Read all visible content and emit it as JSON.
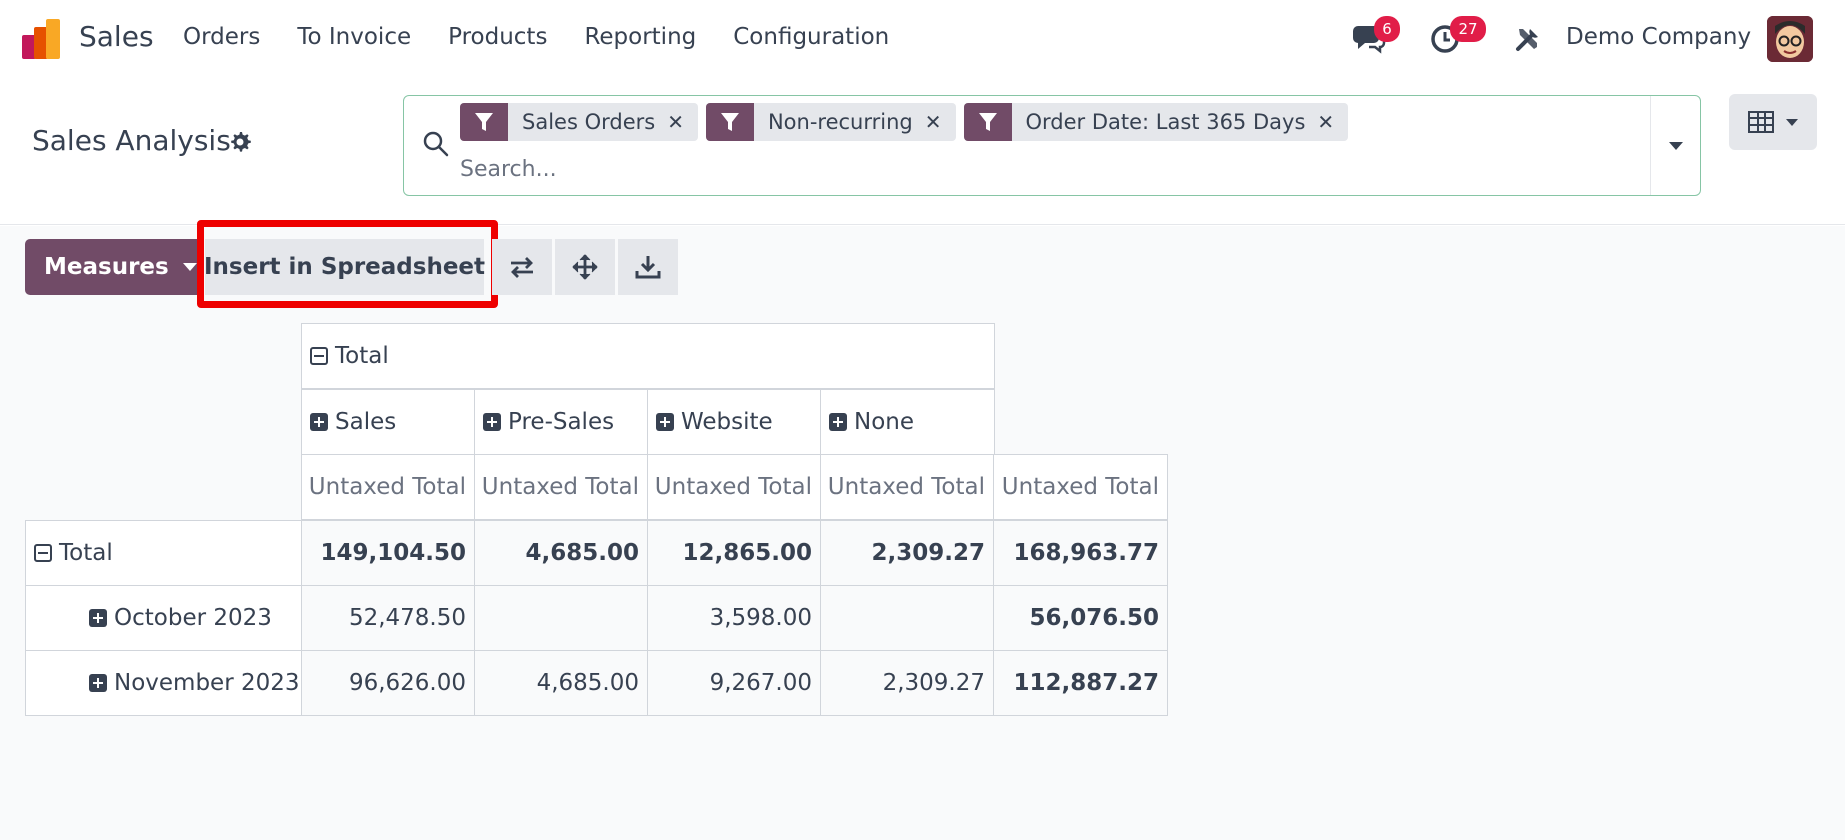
{
  "navbar": {
    "app_name": "Sales",
    "menu": [
      "Orders",
      "To Invoice",
      "Products",
      "Reporting",
      "Configuration"
    ],
    "messages_badge": "6",
    "activities_badge": "27",
    "company": "Demo Company"
  },
  "control_panel": {
    "breadcrumb": "Sales Analysis",
    "facets": [
      {
        "label": "Sales Orders"
      },
      {
        "label": "Non-recurring"
      },
      {
        "label": "Order Date: Last 365 Days"
      }
    ],
    "search_placeholder": "Search..."
  },
  "toolbar": {
    "measures_label": "Measures",
    "insert_label": "Insert in Spreadsheet"
  },
  "pivot": {
    "col_group_total": "Total",
    "col_headers": [
      "Sales",
      "Pre-Sales",
      "Website",
      "None"
    ],
    "measure_label": "Untaxed Total",
    "rows": [
      {
        "label": "Total",
        "values": [
          "149,104.50",
          "4,685.00",
          "12,865.00",
          "2,309.27",
          "168,963.77"
        ]
      },
      {
        "label": "October 2023",
        "values": [
          "52,478.50",
          "",
          "3,598.00",
          "",
          "56,076.50"
        ]
      },
      {
        "label": "November 2023",
        "values": [
          "96,626.00",
          "4,685.00",
          "9,267.00",
          "2,309.27",
          "112,887.27"
        ]
      }
    ]
  },
  "colors": {
    "brand": "#714b67",
    "badge": "#e11d48",
    "highlight": "#ee0000"
  }
}
